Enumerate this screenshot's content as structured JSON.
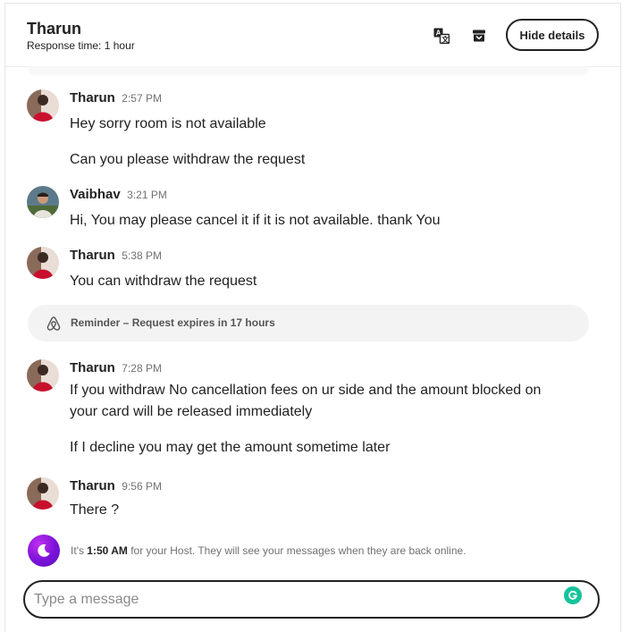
{
  "header": {
    "host_name": "Tharun",
    "response_time": "Response time: 1 hour",
    "hide_details_label": "Hide details",
    "translate_icon": "translate-icon",
    "archive_icon": "archive-icon"
  },
  "messages": [
    {
      "sender": "Tharun",
      "time": "2:57 PM",
      "avatar": "tharun",
      "lines": [
        "Hey sorry room is not available",
        "Can you please withdraw the request"
      ]
    },
    {
      "sender": "Vaibhav",
      "time": "3:21 PM",
      "avatar": "vaibhav",
      "lines": [
        "Hi, You may please cancel it if it is not available. thank You"
      ]
    },
    {
      "sender": "Tharun",
      "time": "5:38 PM",
      "avatar": "tharun",
      "lines": [
        "You can withdraw the request"
      ]
    },
    {
      "sender": "Tharun",
      "time": "7:28 PM",
      "avatar": "tharun",
      "lines": [
        "If you withdraw No cancellation fees on ur side and the amount blocked on your card will be released immediately",
        "If I decline you may get the amount sometime later"
      ]
    },
    {
      "sender": "Tharun",
      "time": "9:56 PM",
      "avatar": "tharun",
      "lines": [
        "There ?"
      ]
    }
  ],
  "reminder": {
    "text": "Reminder – Request expires in 17 hours",
    "icon": "airbnb-logo-icon"
  },
  "status": {
    "prefix": "It's ",
    "time": "1:50 AM",
    "suffix": " for your Host. They will see your messages when they are back online.",
    "icon": "moon-icon"
  },
  "composer": {
    "placeholder": "Type a message",
    "value": "",
    "grammarly_icon": "grammarly-icon"
  },
  "colors": {
    "text": "#222222",
    "muted": "#717171",
    "reminder_bg": "#f3f3f3",
    "moon_bg": "#7a12d8",
    "grammarly": "#15c39a"
  }
}
